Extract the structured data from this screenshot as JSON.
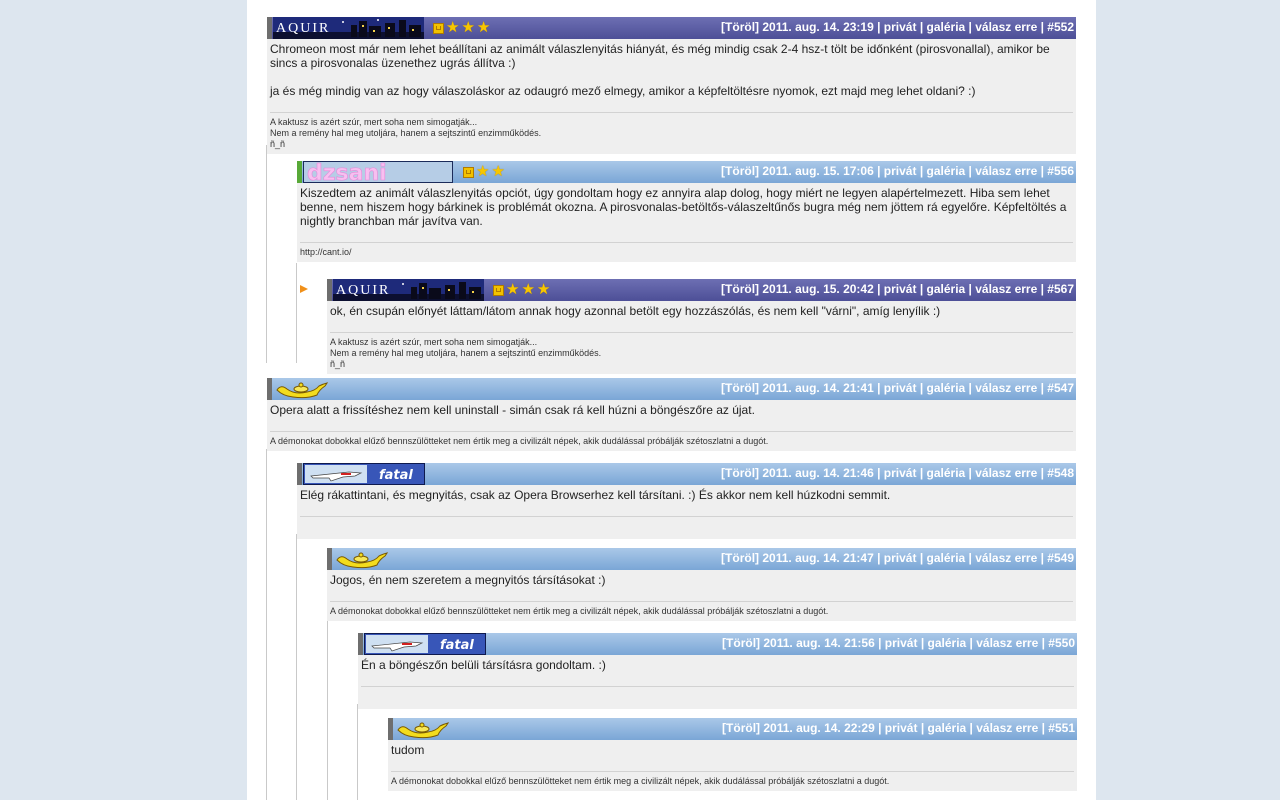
{
  "comments": [
    {
      "id": "c552",
      "user": "AQUIR",
      "meta": "[Töröl] 2011. aug. 14. 23:19 | privát | galéria | válasz erre | #552",
      "body": [
        "Chromeon most már nem lehet beállítani az animált válaszlenyitás hiányát, és még mindig csak 2-4 hsz-t tölt be időnként (pirosvonallal), amikor be sincs a pirosvonalas üzenethez ugrás állítva :)",
        "ja és még mindig van az hogy válaszoláskor az odaugró mező elmegy, amikor a képfeltöltésre nyomok, ezt majd meg lehet oldani? :)"
      ],
      "signature": [
        "A kaktusz is azért szúr, mert soha nem simogatják...",
        "Nem a remény hal meg utoljára, hanem a sejtszintű enzimműködés.",
        "ñ_ñ"
      ]
    },
    {
      "id": "c556",
      "user": "dzsani",
      "meta": "[Töröl] 2011. aug. 15. 17:06 | privát | galéria | válasz erre | #556",
      "body": [
        "Kiszedtem az animált válaszlenyitás opciót, úgy gondoltam hogy ez annyira alap dolog, hogy miért ne legyen alapértelmezett. Hiba sem lehet benne, nem hiszem hogy bárkinek is problémát okozna. A pirosvonalas-betöltős-válaszeltűnős bugra még nem jöttem rá egyelőre. Képfeltöltés a nightly branchban már javítva van."
      ],
      "signature": [
        "http://cant.io/"
      ]
    },
    {
      "id": "c567",
      "user": "AQUIR",
      "meta": "[Töröl] 2011. aug. 15. 20:42 | privát | galéria | válasz erre | #567",
      "body": [
        "ok, én csupán előnyét láttam/látom annak hogy azonnal betölt egy hozzászólás, és nem kell \"várni\", amíg lenyílik :)"
      ],
      "signature": [
        "A kaktusz is azért szúr, mert soha nem simogatják...",
        "Nem a remény hal meg utoljára, hanem a sejtszintű enzimműködés.",
        "ñ_ñ"
      ]
    },
    {
      "id": "c547",
      "user": "lamp",
      "meta": "[Töröl] 2011. aug. 14. 21:41 | privát | galéria | válasz erre | #547",
      "body": [
        "Opera alatt a frissítéshez nem kell uninstall - simán csak rá kell húzni a böngészőre az újat."
      ],
      "signature": [
        "A démonokat dobokkal elűző bennszülötteket nem értik meg a civilizált népek, akik dudálással próbálják szétoszlatni a dugót."
      ]
    },
    {
      "id": "c548",
      "user": "fatal",
      "meta": "[Töröl] 2011. aug. 14. 21:46 | privát | galéria | válasz erre | #548",
      "body": [
        "Elég rákattintani, és megnyitás, csak az Opera Browserhez kell társítani. :) És akkor nem kell húzkodni semmit."
      ],
      "signature": []
    },
    {
      "id": "c549",
      "user": "lamp",
      "meta": "[Töröl] 2011. aug. 14. 21:47 | privát | galéria | válasz erre | #549",
      "body": [
        "Jogos, én nem szeretem a megnyitós társításokat :)"
      ],
      "signature": [
        "A démonokat dobokkal elűző bennszülötteket nem értik meg a civilizált népek, akik dudálással próbálják szétoszlatni a dugót."
      ]
    },
    {
      "id": "c550",
      "user": "fatal",
      "meta": "[Töröl] 2011. aug. 14. 21:56 | privát | galéria | válasz erre | #550",
      "body": [
        "Én a böngészőn belüli társításra gondoltam. :)"
      ],
      "signature": []
    },
    {
      "id": "c551",
      "user": "lamp",
      "meta": "[Töröl] 2011. aug. 14. 22:29 | privát | galéria | válasz erre | #551",
      "body": [
        "tudom"
      ],
      "signature": [
        "A démonokat dobokkal elűző bennszülötteket nem értik meg a civilizált népek, akik dudálással próbálják szétoszlatni a dugót."
      ]
    }
  ],
  "avatars": {
    "AQUIR": "AQUIR",
    "dzsani": "dzsani",
    "fatal": "fatal"
  },
  "colors": {
    "header_blue": "#7aa6d6",
    "header_purple": "#4d4f97",
    "body_bg": "#efefef",
    "page_bg": "#dde6ef",
    "marker_orange": "#f0901a"
  }
}
